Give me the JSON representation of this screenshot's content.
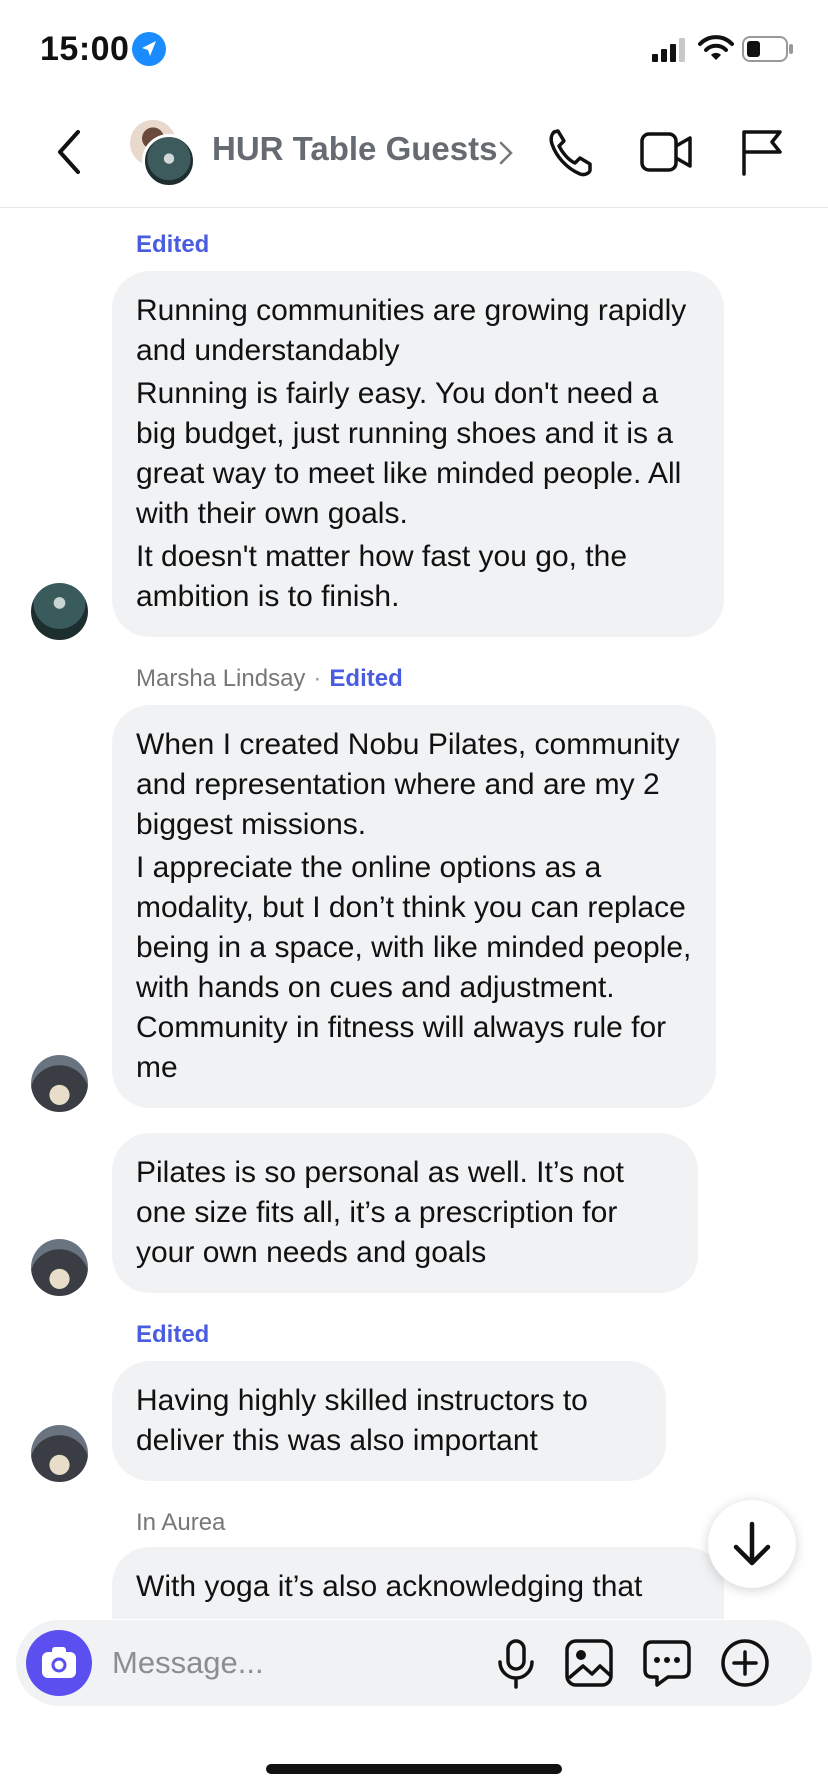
{
  "status_bar": {
    "time": "15:00"
  },
  "header": {
    "title": "HUR Table Guests"
  },
  "messages": [
    {
      "meta": {
        "sender": "",
        "edited": "Edited"
      },
      "paragraphs": [
        "Running communities are growing rapidly and understandably",
        "Running is fairly easy. You don't need a big budget, just running shoes and it is a great way to meet like minded people. All with their own goals.",
        "It doesn't matter how fast you go, the ambition is to finish."
      ]
    },
    {
      "meta": {
        "sender": "Marsha Lindsay",
        "separator": "·",
        "edited": "Edited"
      },
      "paragraphs": [
        "When I created Nobu Pilates, community and representation where and are my 2 biggest missions.",
        "I appreciate the online options as a modality, but I don’t think you can replace being in a space, with like minded people, with hands on cues and adjustment. Community in fitness will always rule for me"
      ]
    },
    {
      "paragraphs": [
        "Pilates is so personal as well. It’s not one size fits all, it’s a prescription for your own needs and goals"
      ]
    },
    {
      "meta": {
        "edited": "Edited"
      },
      "paragraphs": [
        "Having highly skilled instructors to deliver this was also important"
      ]
    },
    {
      "meta": {
        "sender": "In Aurea"
      },
      "paragraphs": [
        "With yoga it’s also acknowledging that"
      ]
    }
  ],
  "composer": {
    "placeholder": "Message..."
  },
  "icons": {
    "location": "location-arrow-icon",
    "signal": "cellular-signal-icon",
    "wifi": "wifi-icon",
    "battery": "battery-icon",
    "back": "chevron-left-icon",
    "call": "phone-icon",
    "video": "video-camera-icon",
    "flag": "flag-icon",
    "scroll": "arrow-down-icon",
    "camera": "camera-icon",
    "mic": "microphone-icon",
    "gallery": "image-icon",
    "sticker": "chat-bubble-icon",
    "plus": "plus-circle-icon"
  },
  "colors": {
    "accent": "#5b4ff0",
    "edited": "#4a5de0",
    "bubble": "#f1f2f4",
    "location": "#1a8cff"
  }
}
